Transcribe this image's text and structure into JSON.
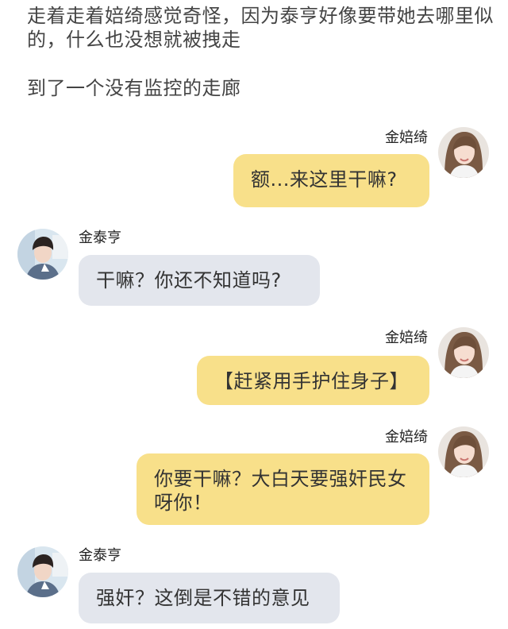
{
  "narration": {
    "line1": "走着走着婄绮感觉奇怪，因为泰亨好像要带她去哪里似的，什么也没想就被拽走",
    "line2": "到了一个没有监控的走廊"
  },
  "messages": [
    {
      "side": "right",
      "speaker": "金婄绮",
      "text": "额...来这里干嘛?"
    },
    {
      "side": "left",
      "speaker": "金泰亨",
      "text": "干嘛？你还不知道吗?"
    },
    {
      "side": "right",
      "speaker": "金婄绮",
      "text": "【赶紧用手护住身子】"
    },
    {
      "side": "right",
      "speaker": "金婄绮",
      "text": "你要干嘛？大白天要强奸民女呀你！"
    },
    {
      "side": "left",
      "speaker": "金泰亨",
      "text": "强奸？这倒是不错的意见"
    }
  ],
  "colors": {
    "right_bubble": "#f8e08a",
    "left_bubble": "#e3e6ed",
    "background": "#ffffff"
  },
  "icons": {
    "female_avatar": "girl-portrait-avatar",
    "male_avatar": "boy-portrait-avatar"
  }
}
